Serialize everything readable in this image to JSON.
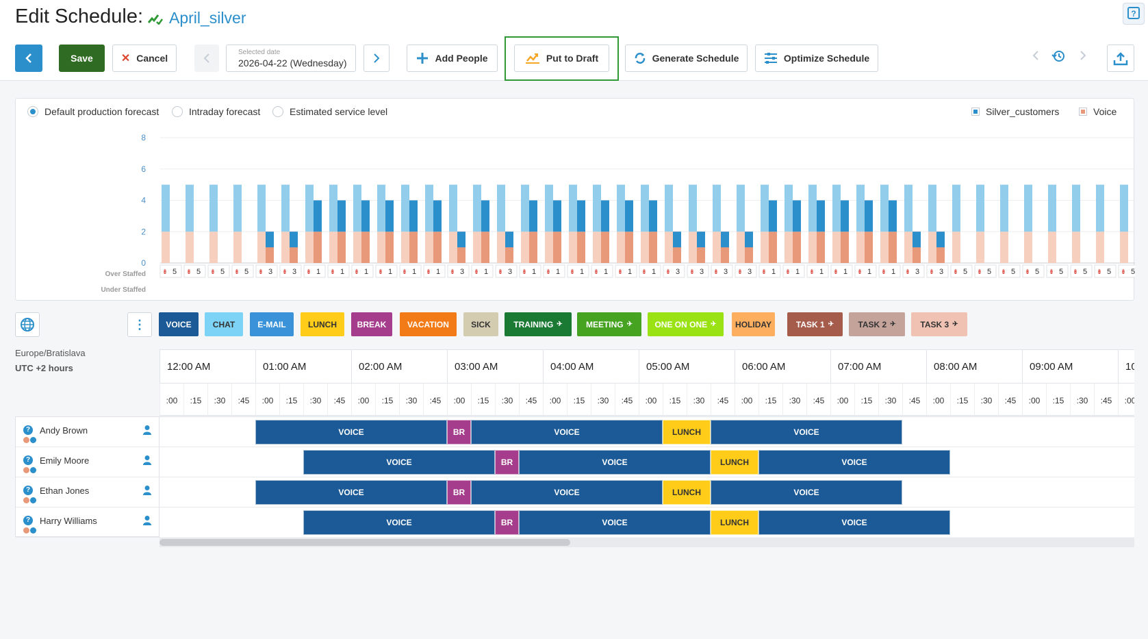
{
  "header": {
    "title": "Edit Schedule:",
    "schedule_name": "April_silver",
    "save_label": "Save",
    "cancel_label": "Cancel",
    "date_label": "Selected date",
    "date_value": "2026-04-22 (Wednesday)",
    "add_people_label": "Add People",
    "put_to_draft_label": "Put to Draft",
    "generate_label": "Generate Schedule",
    "optimize_label": "Optimize Schedule"
  },
  "forecast": {
    "radios": [
      {
        "label": "Default production forecast",
        "selected": true
      },
      {
        "label": "Intraday forecast",
        "selected": false
      },
      {
        "label": "Estimated service level",
        "selected": false
      }
    ],
    "legend": [
      {
        "label": "Silver_customers",
        "color": "#2b8fcb"
      },
      {
        "label": "Voice",
        "color": "#e8997a"
      }
    ],
    "over_label": "Over Staffed",
    "under_label": "Under Staffed",
    "chart_data": {
      "type": "bar",
      "ylim": [
        0,
        8
      ],
      "yticks": [
        0,
        2,
        4,
        6,
        8
      ],
      "series": [
        {
          "name": "Silver_customers",
          "values": [
            5,
            5,
            5,
            5,
            3,
            3,
            1,
            1,
            1,
            1,
            1,
            1,
            3,
            1,
            3,
            1,
            1,
            1,
            1,
            1,
            1,
            3,
            3,
            3,
            3,
            1,
            1,
            1,
            1,
            1,
            1,
            3,
            3,
            5,
            5,
            5,
            5,
            5,
            5,
            5,
            5
          ]
        },
        {
          "name": "Voice",
          "values": [
            5,
            5,
            5,
            5,
            3,
            3,
            1,
            1,
            1,
            1,
            1,
            1,
            3,
            1,
            3,
            1,
            1,
            1,
            1,
            1,
            1,
            3,
            3,
            3,
            3,
            1,
            1,
            1,
            1,
            1,
            1,
            3,
            3,
            5,
            5,
            5,
            5,
            5,
            5,
            5,
            5
          ]
        }
      ],
      "under_staffed": [
        5,
        5,
        5,
        5,
        3,
        3,
        1,
        1,
        1,
        1,
        1,
        1,
        3,
        1,
        3,
        1,
        1,
        1,
        1,
        1,
        1,
        3,
        3,
        3,
        3,
        1,
        1,
        1,
        1,
        1,
        1,
        3,
        3,
        5,
        5,
        5,
        5,
        5,
        5,
        5,
        5
      ]
    }
  },
  "activities": [
    {
      "label": "VOICE",
      "bg": "#1b5a96",
      "fg": "#fff",
      "pin": false
    },
    {
      "label": "CHAT",
      "bg": "#7dd3f5",
      "fg": "#333",
      "pin": false
    },
    {
      "label": "E-MAIL",
      "bg": "#3a93d8",
      "fg": "#fff",
      "pin": false
    },
    {
      "label": "LUNCH",
      "bg": "#ffcc1a",
      "fg": "#333",
      "pin": false
    },
    {
      "label": "BREAK",
      "bg": "#a53d8c",
      "fg": "#fff",
      "pin": false
    },
    {
      "label": "VACATION",
      "bg": "#f27b17",
      "fg": "#fff",
      "pin": false
    },
    {
      "label": "SICK",
      "bg": "#d4ccb1",
      "fg": "#333",
      "pin": false
    },
    {
      "label": "TRAINING",
      "bg": "#1a7a34",
      "fg": "#fff",
      "pin": true
    },
    {
      "label": "MEETING",
      "bg": "#45a321",
      "fg": "#fff",
      "pin": true
    },
    {
      "label": "ONE ON ONE",
      "bg": "#9be214",
      "fg": "#fff",
      "pin": true
    },
    {
      "label": "HOLIDAY",
      "bg": "#fdae5e",
      "fg": "#333",
      "pin": false
    },
    {
      "label": "TASK 1",
      "bg": "#a65c4a",
      "fg": "#fff",
      "pin": true
    },
    {
      "label": "TASK 2",
      "bg": "#c4a49a",
      "fg": "#333",
      "pin": true
    },
    {
      "label": "TASK 3",
      "bg": "#f0c2b3",
      "fg": "#333",
      "pin": true
    }
  ],
  "timezone": {
    "region": "Europe/Bratislava",
    "offset": "UTC +2 hours"
  },
  "timeline": {
    "hours": [
      "12:00 AM",
      "01:00 AM",
      "02:00 AM",
      "03:00 AM",
      "04:00 AM",
      "05:00 AM",
      "06:00 AM",
      "07:00 AM",
      "08:00 AM",
      "09:00 AM",
      "10"
    ],
    "quarters": [
      ":00",
      ":15",
      ":30",
      ":45"
    ]
  },
  "people": [
    {
      "name": "Andy Brown",
      "shifts": [
        {
          "label": "VOICE",
          "start": 1.0,
          "end": 3.0,
          "type": "VOICE"
        },
        {
          "label": "BR",
          "start": 3.0,
          "end": 3.25,
          "type": "BREAK"
        },
        {
          "label": "VOICE",
          "start": 3.25,
          "end": 5.25,
          "type": "VOICE"
        },
        {
          "label": "LUNCH",
          "start": 5.25,
          "end": 5.75,
          "type": "LUNCH"
        },
        {
          "label": "VOICE",
          "start": 5.75,
          "end": 7.75,
          "type": "VOICE"
        }
      ]
    },
    {
      "name": "Emily Moore",
      "shifts": [
        {
          "label": "VOICE",
          "start": 1.5,
          "end": 3.5,
          "type": "VOICE"
        },
        {
          "label": "BR",
          "start": 3.5,
          "end": 3.75,
          "type": "BREAK"
        },
        {
          "label": "VOICE",
          "start": 3.75,
          "end": 5.75,
          "type": "VOICE"
        },
        {
          "label": "LUNCH",
          "start": 5.75,
          "end": 6.25,
          "type": "LUNCH"
        },
        {
          "label": "VOICE",
          "start": 6.25,
          "end": 8.25,
          "type": "VOICE"
        }
      ]
    },
    {
      "name": "Ethan Jones",
      "shifts": [
        {
          "label": "VOICE",
          "start": 1.0,
          "end": 3.0,
          "type": "VOICE"
        },
        {
          "label": "BR",
          "start": 3.0,
          "end": 3.25,
          "type": "BREAK"
        },
        {
          "label": "VOICE",
          "start": 3.25,
          "end": 5.25,
          "type": "VOICE"
        },
        {
          "label": "LUNCH",
          "start": 5.25,
          "end": 5.75,
          "type": "LUNCH"
        },
        {
          "label": "VOICE",
          "start": 5.75,
          "end": 7.75,
          "type": "VOICE"
        }
      ]
    },
    {
      "name": "Harry Williams",
      "shifts": [
        {
          "label": "VOICE",
          "start": 1.5,
          "end": 3.5,
          "type": "VOICE"
        },
        {
          "label": "BR",
          "start": 3.5,
          "end": 3.75,
          "type": "BREAK"
        },
        {
          "label": "VOICE",
          "start": 3.75,
          "end": 5.75,
          "type": "VOICE"
        },
        {
          "label": "LUNCH",
          "start": 5.75,
          "end": 6.25,
          "type": "LUNCH"
        },
        {
          "label": "VOICE",
          "start": 6.25,
          "end": 8.25,
          "type": "VOICE"
        }
      ]
    }
  ]
}
